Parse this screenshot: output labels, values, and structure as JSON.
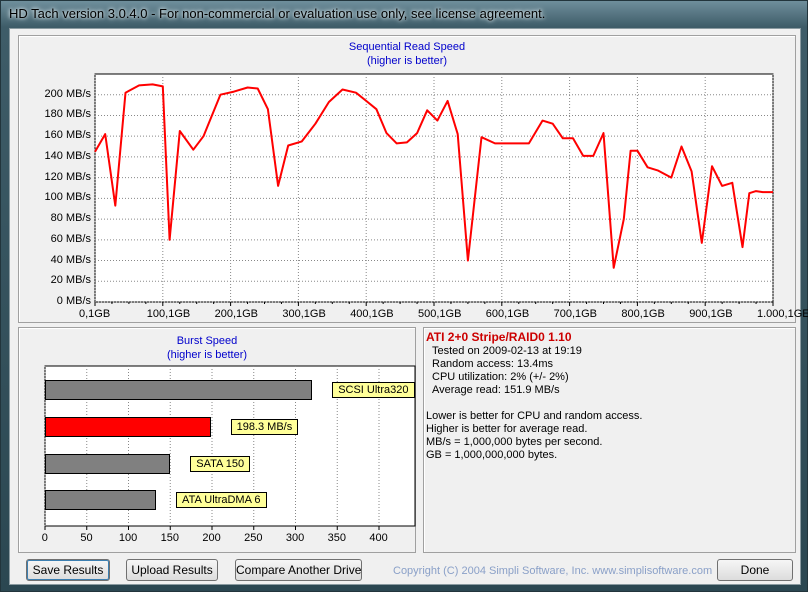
{
  "window": {
    "title": "HD Tach version 3.0.4.0  - For non-commercial or evaluation use only, see license agreement."
  },
  "sequential": {
    "title": "Sequential Read Speed",
    "subtitle": "(higher is better)",
    "y_ticks": [
      "0 MB/s",
      "20 MB/s",
      "40 MB/s",
      "60 MB/s",
      "80 MB/s",
      "100 MB/s",
      "120 MB/s",
      "140 MB/s",
      "160 MB/s",
      "180 MB/s",
      "200 MB/s"
    ],
    "x_ticks": [
      "0,1GB",
      "100,1GB",
      "200,1GB",
      "300,1GB",
      "400,1GB",
      "500,1GB",
      "600,1GB",
      "700,1GB",
      "800,1GB",
      "900,1GB",
      "1.000,1GE"
    ],
    "line_color": "#ff0000"
  },
  "burst": {
    "title": "Burst Speed",
    "subtitle": "(higher is better)",
    "x_ticks": [
      "0",
      "50",
      "100",
      "150",
      "200",
      "250",
      "300",
      "350",
      "400"
    ]
  },
  "info": {
    "heading": "ATI 2+0 Stripe/RAID0 1.10",
    "lines": [
      "Tested on 2009-02-13 at 19:19",
      "Random access: 13.4ms",
      "CPU utilization: 2% (+/- 2%)",
      "Average read: 151.9 MB/s"
    ],
    "notes": [
      "Lower is better for CPU and random access.",
      "Higher is better for average read.",
      "MB/s = 1,000,000 bytes per second.",
      "GB = 1,000,000,000 bytes."
    ]
  },
  "buttons": {
    "save": "Save Results",
    "upload": "Upload Results",
    "compare": "Compare Another Drive",
    "done": "Done"
  },
  "copyright": "Copyright (C) 2004 Simpli Software, Inc. www.simplisoftware.com",
  "chart_data": [
    {
      "type": "line",
      "title": "Sequential Read Speed",
      "subtitle": "(higher is better)",
      "xlabel": "",
      "ylabel": "",
      "x_unit": "GB",
      "y_unit": "MB/s",
      "xlim": [
        0.1,
        1000.1
      ],
      "ylim": [
        0,
        220
      ],
      "grid": true,
      "series": [
        {
          "color": "#ff0000",
          "x": [
            0,
            15,
            30,
            45,
            65,
            85,
            100,
            110,
            125,
            145,
            160,
            185,
            205,
            225,
            240,
            255,
            270,
            285,
            305,
            325,
            345,
            365,
            385,
            400,
            415,
            430,
            445,
            460,
            475,
            490,
            505,
            520,
            535,
            550,
            570,
            590,
            615,
            640,
            660,
            675,
            690,
            705,
            720,
            735,
            750,
            765,
            780,
            790,
            800,
            815,
            830,
            850,
            865,
            880,
            895,
            910,
            925,
            940,
            955,
            965,
            975,
            985,
            1000
          ],
          "y": [
            145,
            162,
            93,
            202,
            209,
            210,
            208,
            60,
            165,
            147,
            160,
            200,
            203,
            207,
            206,
            186,
            112,
            151,
            155,
            172,
            193,
            205,
            202,
            194,
            186,
            163,
            153,
            154,
            163,
            185,
            175,
            194,
            162,
            40,
            159,
            153,
            153,
            153,
            175,
            172,
            158,
            158,
            141,
            141,
            163,
            33,
            80,
            146,
            146,
            130,
            127,
            120,
            150,
            126,
            57,
            131,
            112,
            115,
            53,
            105,
            107,
            106,
            106
          ]
        }
      ]
    },
    {
      "type": "bar",
      "title": "Burst Speed",
      "subtitle": "(higher is better)",
      "orientation": "horizontal",
      "xlim": [
        0,
        400
      ],
      "categories": [
        "SCSI Ultra320",
        "198.3 MB/s",
        "SATA 150",
        "ATA UltraDMA 6"
      ],
      "values": [
        320,
        198.3,
        150,
        133
      ],
      "colors": [
        "#808080",
        "#ff0000",
        "#808080",
        "#808080"
      ]
    }
  ]
}
